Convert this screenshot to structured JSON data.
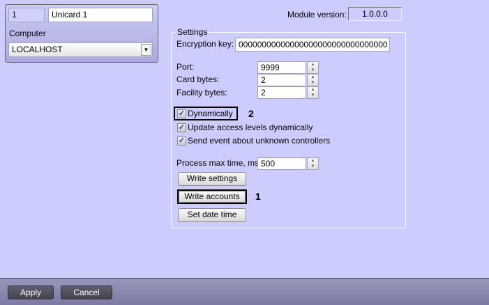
{
  "device": {
    "id": "1",
    "name": "Unicard 1",
    "computer_label": "Computer",
    "computer_value": "LOCALHOST"
  },
  "module": {
    "label": "Module version:",
    "value": "1.0.0.0"
  },
  "settings": {
    "legend": "Settings",
    "encryption_label": "Encryption key:",
    "encryption_value": "00000000000000000000000000000000",
    "port_label": "Port:",
    "port_value": "9999",
    "card_label": "Card bytes:",
    "card_value": "2",
    "facility_label": "Facility bytes:",
    "facility_value": "2",
    "dynamically_label": "Dynamically",
    "dynamically_checked": true,
    "update_label": "Update access levels dynamically",
    "update_checked": true,
    "send_label": "Send event about unknown controllers",
    "send_checked": true,
    "process_label": "Process max time, ms:",
    "process_value": "500",
    "write_settings": "Write settings",
    "write_accounts": "Write accounts",
    "set_date_time": "Set date time"
  },
  "annotations": {
    "one": "1",
    "two": "2"
  },
  "footer": {
    "apply": "Apply",
    "cancel": "Cancel"
  }
}
